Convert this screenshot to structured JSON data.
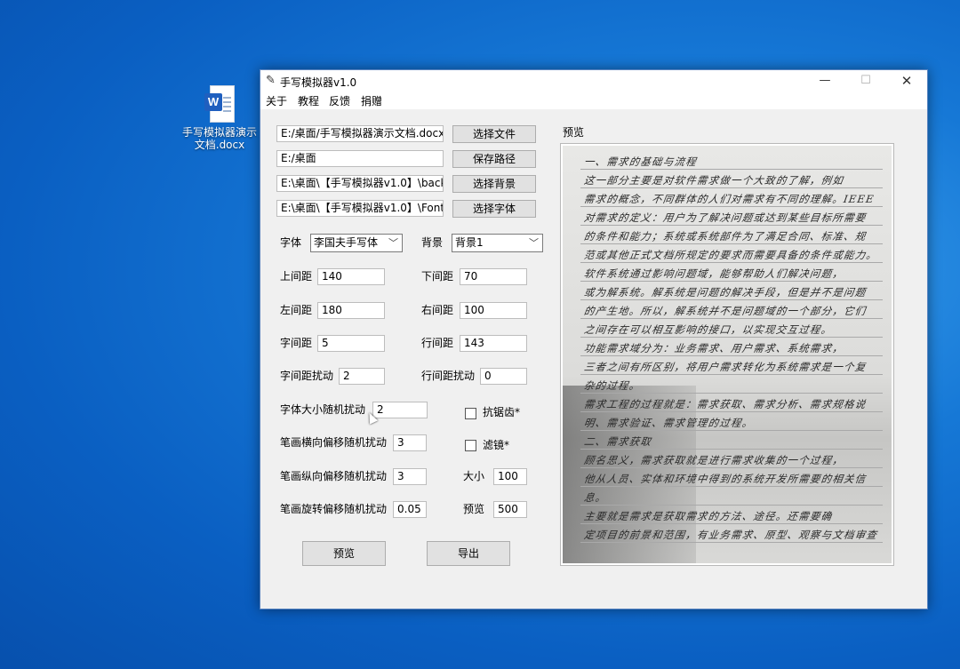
{
  "desktop": {
    "file_icon": "word-doc-icon",
    "file_badge": "W",
    "file_name": "手写模拟器演示文档.docx"
  },
  "window": {
    "title": "手写模拟器v1.0",
    "controls": {
      "minimize": "—",
      "maximize": "☐",
      "close": "✕"
    }
  },
  "menu": {
    "items": [
      "关于",
      "教程",
      "反馈",
      "捐赠"
    ]
  },
  "files": {
    "doc_path": "E:/桌面/手写模拟器演示文档.docx",
    "save_path": "E:/桌面",
    "bg_path": "E:\\桌面\\【手写模拟器v1.0】\\backgr",
    "font_path": "E:\\桌面\\【手写模拟器v1.0】\\Fonts\\字",
    "select_file": "选择文件",
    "save_path_btn": "保存路径",
    "select_bg": "选择背景",
    "select_font": "选择字体"
  },
  "font": {
    "label": "字体",
    "value": "李国夫手写体"
  },
  "background": {
    "label": "背景",
    "value": "背景1"
  },
  "margins": {
    "top_label": "上间距",
    "top": "140",
    "bottom_label": "下间距",
    "bottom": "70",
    "left_label": "左间距",
    "left": "180",
    "right_label": "右间距",
    "right": "100"
  },
  "spacing": {
    "char_label": "字间距",
    "char": "5",
    "line_label": "行间距",
    "line": "143",
    "char_jitter_label": "字间距扰动",
    "char_jitter": "2",
    "line_jitter_label": "行间距扰动",
    "line_jitter": "0"
  },
  "random": {
    "size_label": "字体大小随机扰动",
    "size": "2",
    "hshift_label": "笔画横向偏移随机扰动",
    "hshift": "3",
    "vshift_label": "笔画纵向偏移随机扰动",
    "vshift": "3",
    "rot_label": "笔画旋转偏移随机扰动",
    "rot": "0.05"
  },
  "options": {
    "antialias_label": "抗锯齿*",
    "antialias_checked": false,
    "filter_label": "滤镜*",
    "filter_checked": false,
    "size_label": "大小",
    "size": "100",
    "preview_label": "预览",
    "preview": "500"
  },
  "actions": {
    "preview": "预览",
    "export": "导出"
  },
  "preview_panel": {
    "label": "预览",
    "lines": [
      "一、需求的基础与流程",
      "这一部分主要是对软件需求做一个大致的了解，例如",
      "需求的概念，不同群体的人们对需求有不同的理解。IEEE",
      "对需求的定义：用户为了解决问题或达到某些目标所需要",
      "的条件和能力；系统或系统部件为了满足合同、标准、规",
      "范或其他正式文档所规定的要求而需要具备的条件或能力。",
      "软件系统通过影响问题域，能够帮助人们解决问题，",
      "或为解系统。解系统是问题的解决手段，但是并不是问题",
      "的产生地。所以，解系统并不是问题域的一个部分，它们",
      "之间存在可以相互影响的接口，以实现交互过程。",
      "功能需求域分为：业务需求、用户需求、系统需求，",
      "三者之间有所区别，将用户需求转化为系统需求是一个复",
      "杂的过程。",
      "需求工程的过程就是：需求获取、需求分析、需求规格说",
      "明、需求验证、需求管理的过程。",
      "二、需求获取",
      "顾名思义，需求获取就是进行需求收集的一个过程，",
      "他从人员、实体和环境中得到的系统开发所需要的相关信",
      "息。",
      "主要就是需求是获取需求的方法、途径。还需要确",
      "定项目的前景和范围，有业务需求、原型、观察与文档审查"
    ]
  }
}
